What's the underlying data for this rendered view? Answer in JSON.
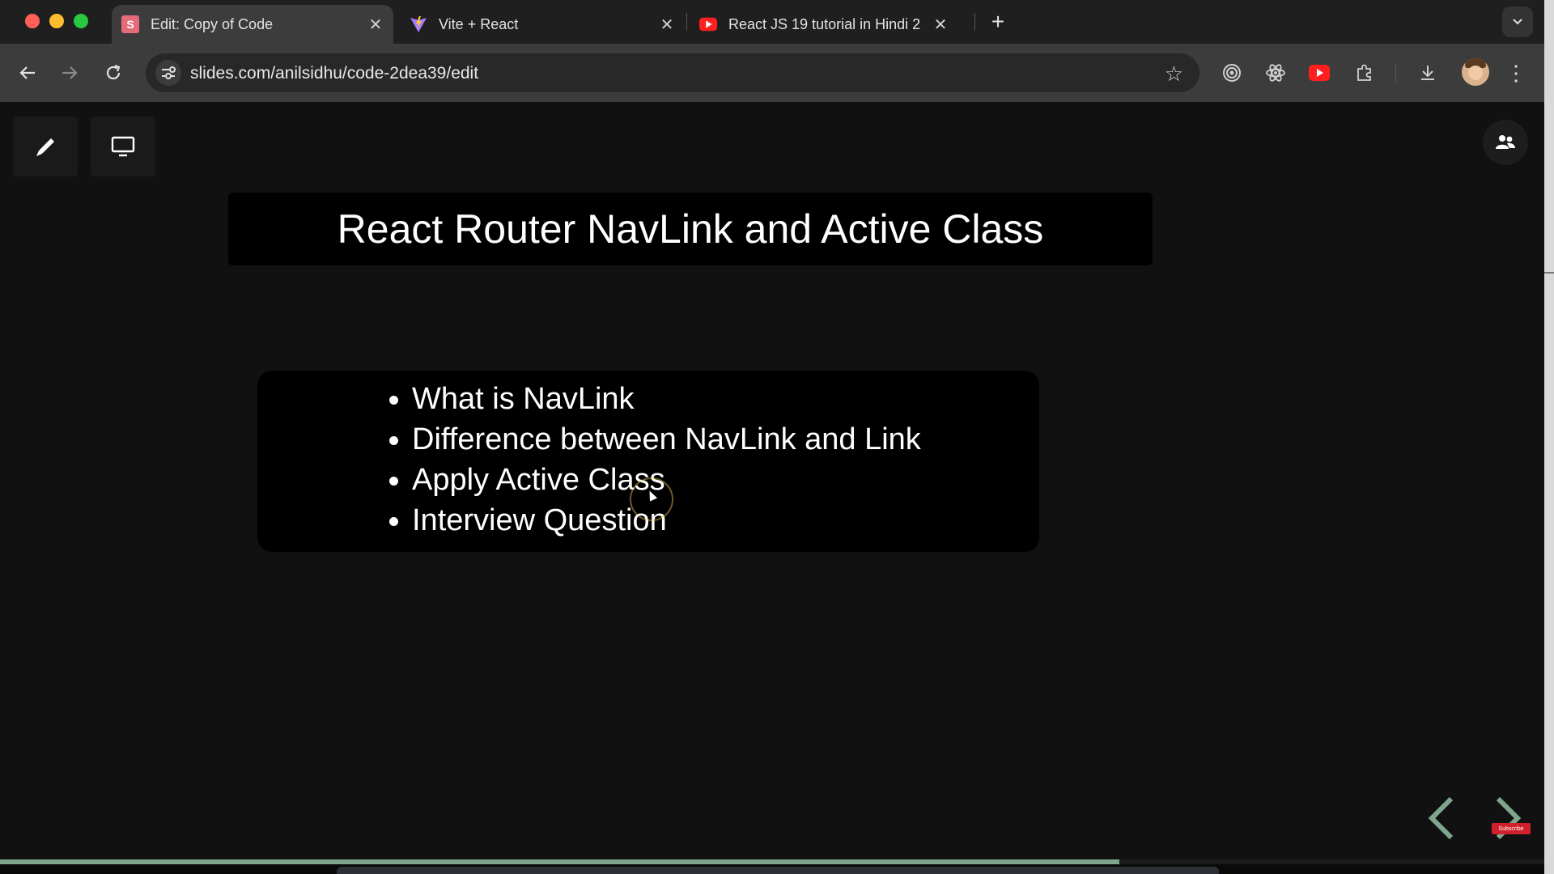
{
  "browser": {
    "tabs": [
      {
        "label": "Edit: Copy of Code",
        "icon": "slides-favicon-icon",
        "active": true
      },
      {
        "label": "Vite + React",
        "icon": "vite-favicon-icon",
        "active": false
      },
      {
        "label": "React JS 19 tutorial in Hindi 2",
        "icon": "youtube-favicon-icon",
        "active": false
      }
    ],
    "slides_favicon_letter": "S",
    "url": "slides.com/anilsidhu/code-2dea39/edit",
    "extensions": [
      "target-icon",
      "react-icon",
      "youtube-icon",
      "puzzle-icon"
    ]
  },
  "slide": {
    "title": "React Router NavLink and Active Class",
    "bullets": [
      "What is NavLink",
      "Difference between NavLink and Link",
      "Apply Active Class",
      "Interview Question"
    ]
  },
  "presentation": {
    "progress": 0.725,
    "accent": "#7fa58d"
  },
  "overlay": {
    "subscribe_label": "Subscribe"
  }
}
